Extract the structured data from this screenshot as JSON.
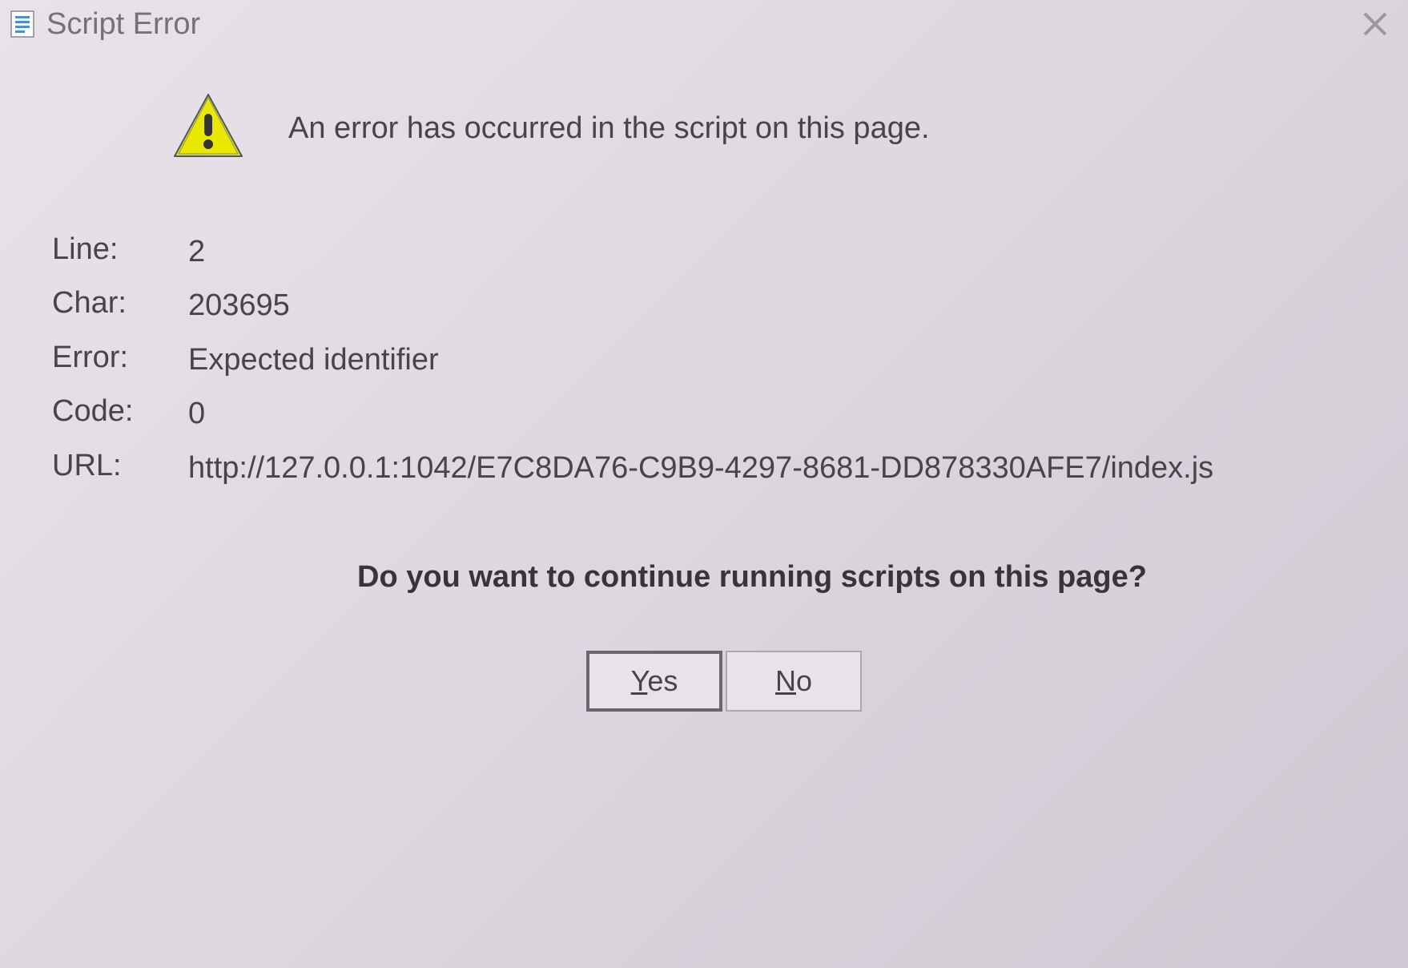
{
  "title": "Script Error",
  "header_message": "An error has occurred in the script on this page.",
  "details": {
    "line_label": "Line:",
    "line_value": "2",
    "char_label": "Char:",
    "char_value": "203695",
    "error_label": "Error:",
    "error_value": "Expected identifier",
    "code_label": "Code:",
    "code_value": "0",
    "url_label": "URL:",
    "url_value": "http://127.0.0.1:1042/E7C8DA76-C9B9-4297-8681-DD878330AFE7/index.js"
  },
  "question": "Do you want to continue running scripts on this page?",
  "buttons": {
    "yes": "Yes",
    "no": "No"
  }
}
